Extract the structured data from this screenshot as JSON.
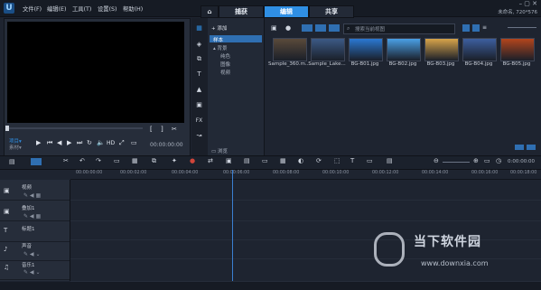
{
  "menu": {
    "file": "文件(F)",
    "edit": "编辑(E)",
    "tools": "工具(T)",
    "settings": "设置(S)",
    "help": "帮助(H)"
  },
  "tabs": {
    "capture": "捕获",
    "edit": "编辑",
    "share": "共享"
  },
  "project_info": "未命名, 720*576",
  "preview": {
    "mode_label": "项目▾",
    "clip_label": "素材▾",
    "timecode": "00:00:00:00"
  },
  "library": {
    "add_label": "添加",
    "folders": [
      {
        "name": "样本"
      },
      {
        "name": "背景"
      },
      {
        "name": "纯色"
      },
      {
        "name": "图像"
      },
      {
        "name": "视频"
      }
    ],
    "browse_label": "浏览",
    "search_placeholder": "搜索当前视图"
  },
  "media": [
    {
      "name": "Sample_360.m...",
      "color": "#5a4a3a"
    },
    {
      "name": "Sample_Lake...",
      "color": "#3c5a86"
    },
    {
      "name": "BG-B01.jpg",
      "color": "#2a78d2"
    },
    {
      "name": "BG-B02.jpg",
      "color": "#4aa0e6"
    },
    {
      "name": "BG-B03.jpg",
      "color": "#d8a44a"
    },
    {
      "name": "BG-B04.jpg",
      "color": "#3d5f9f"
    },
    {
      "name": "BG-B05.jpg",
      "color": "#b3451c"
    }
  ],
  "timeline": {
    "toolbar_timecode": "0:00:00:00",
    "ruler": [
      "00:00:00:00",
      "00:00:02:00",
      "00:00:04:00",
      "00:00:06:00",
      "00:00:08:00",
      "00:00:10:00",
      "00:00:12:00",
      "00:00:14:00",
      "00:00:16:00",
      "00:00:18:00"
    ],
    "tracks": [
      "视频",
      "叠加1",
      "标题1",
      "声音",
      "音乐1"
    ]
  },
  "watermark": {
    "brand": "当下软件园",
    "url": "www.downxia.com"
  },
  "colors": {
    "accent": "#2f8fe4",
    "panel": "#262d3a",
    "background": "#1e2430"
  }
}
